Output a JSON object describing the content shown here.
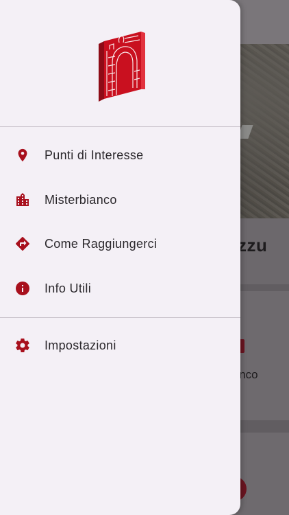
{
  "background": {
    "title_fragment": "azzu",
    "card_text_fragment": "ianco"
  },
  "drawer": {
    "logo": {
      "icon": "misterbianco-logo"
    },
    "menu": [
      {
        "label": "Punti di Interesse",
        "icon": "location-pin-icon"
      },
      {
        "label": "Misterbianco",
        "icon": "city-icon"
      },
      {
        "label": "Come Raggiungerci",
        "icon": "directions-icon"
      },
      {
        "label": "Info Utili",
        "icon": "info-icon"
      }
    ],
    "settings": {
      "label": "Impostazioni",
      "icon": "gear-icon"
    }
  },
  "colors": {
    "accent": "#b0101f",
    "drawer_bg": "#f4f0f6",
    "text": "#2b282c"
  }
}
